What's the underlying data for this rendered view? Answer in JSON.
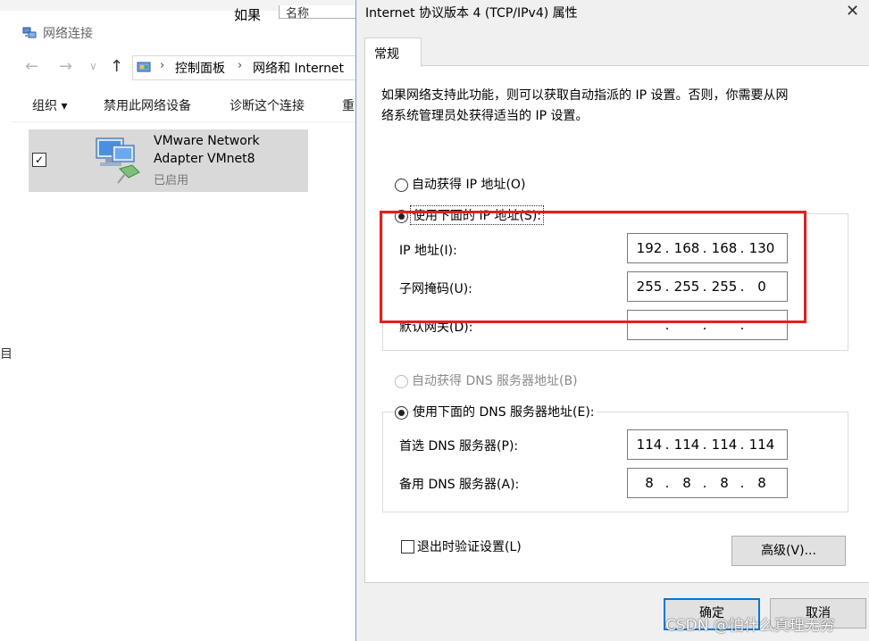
{
  "explorer": {
    "header_partial": "如果",
    "header_partial2": "名称",
    "title": "网络连接",
    "breadcrumb": [
      "控制面板",
      "网络和 Internet"
    ],
    "commands": [
      "组织 ▾",
      "禁用此网络设备",
      "诊断这个连接",
      "重"
    ],
    "left_partial": "目",
    "adapter": {
      "name_line1": "VMware Network",
      "name_line2": "Adapter VMnet8",
      "status": "已启用",
      "checked": true
    }
  },
  "dialog": {
    "title": "Internet 协议版本 4 (TCP/IPv4) 属性",
    "close": "✕",
    "tab": "常规",
    "description_line1": "如果网络支持此功能，则可以获取自动指派的 IP 设置。否则，你需要从网",
    "description_line2": "络系统管理员处获得适当的 IP 设置。",
    "auto_ip_label": "自动获得 IP 地址(O)",
    "manual_ip_label": "使用下面的 IP 地址(S):",
    "ip_label": "IP 地址(I):",
    "ip_value": [
      "192",
      "168",
      "168",
      "130"
    ],
    "mask_label": "子网掩码(U):",
    "mask_value": [
      "255",
      "255",
      "255",
      "0"
    ],
    "gateway_label": "默认网关(D):",
    "gateway_value": [
      "",
      "",
      "",
      ""
    ],
    "auto_dns_label": "自动获得 DNS 服务器地址(B)",
    "manual_dns_label": "使用下面的 DNS 服务器地址(E):",
    "preferred_dns_label": "首选 DNS 服务器(P):",
    "preferred_dns_value": [
      "114",
      "114",
      "114",
      "114"
    ],
    "alternate_dns_label": "备用 DNS 服务器(A):",
    "alternate_dns_value": [
      "8",
      "8",
      "8",
      "8"
    ],
    "validate_label": "退出时验证设置(L)",
    "advanced_button": "高级(V)...",
    "ok_button": "确定",
    "cancel_button": "取消"
  },
  "watermark": "CSDN @怕什么真理无穷",
  "colors": {
    "highlight_box": "#e02020",
    "dialog_bg": "#f0f0f0",
    "default_button_border": "#0078d7",
    "selected_item_bg": "#d9d9d9"
  }
}
